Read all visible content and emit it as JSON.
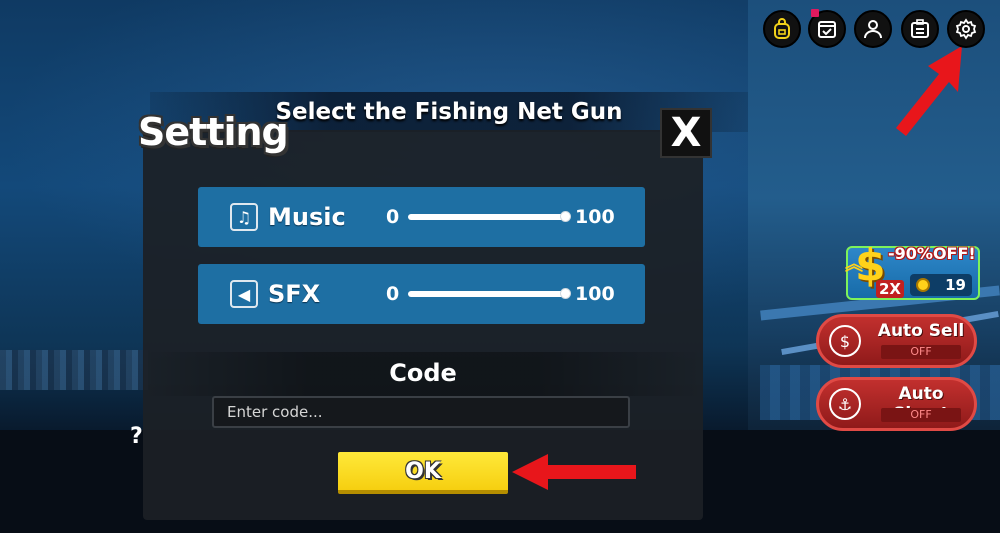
{
  "screen_title": "Select the Fishing Net Gun",
  "settings": {
    "title": "Setting",
    "close_label": "X",
    "music": {
      "label": "Music",
      "min": "0",
      "max": "100",
      "value": 100
    },
    "sfx": {
      "label": "SFX",
      "min": "0",
      "max": "100",
      "value": 100
    },
    "code": {
      "title": "Code",
      "placeholder": "Enter code...",
      "value": ""
    },
    "ok_label": "OK"
  },
  "hud": {
    "top_icons": [
      "backpack-icon",
      "calendar-check-icon",
      "profile-icon",
      "clipboard-icon",
      "gear-icon"
    ],
    "question_mark": "?",
    "boost": {
      "discount": "-90%OFF!",
      "multiplier": "2X",
      "price": "19"
    },
    "auto_sell": {
      "label": "Auto Sell",
      "state": "OFF"
    },
    "auto_shoot": {
      "label": "Auto Shoot",
      "state": "OFF"
    }
  },
  "colors": {
    "row_blue": "#1e6fa3",
    "ok_yellow": "#f6cf10",
    "arrow_red": "#e8161b",
    "toggle_red": "#c2302e"
  }
}
